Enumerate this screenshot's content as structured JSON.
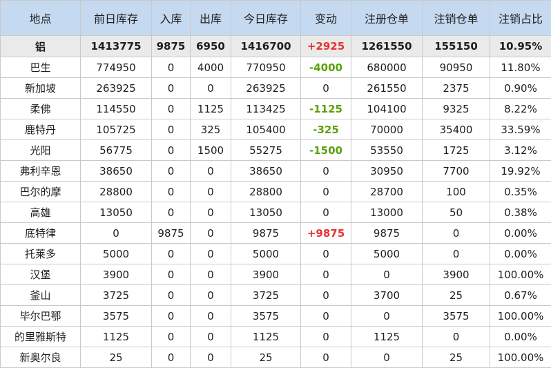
{
  "headers": [
    "地点",
    "前日库存",
    "入库",
    "出库",
    "今日库存",
    "变动",
    "注册仓单",
    "注销仓单",
    "注销占比"
  ],
  "rows": [
    [
      "铝",
      "1413775",
      "9875",
      "6950",
      "1416700",
      "+2925",
      "1261550",
      "155150",
      "10.95%"
    ],
    [
      "巴生",
      "774950",
      "0",
      "4000",
      "770950",
      "-4000",
      "680000",
      "90950",
      "11.80%"
    ],
    [
      "新加坡",
      "263925",
      "0",
      "0",
      "263925",
      "0",
      "261550",
      "2375",
      "0.90%"
    ],
    [
      "柔佛",
      "114550",
      "0",
      "1125",
      "113425",
      "-1125",
      "104100",
      "9325",
      "8.22%"
    ],
    [
      "鹿特丹",
      "105725",
      "0",
      "325",
      "105400",
      "-325",
      "70000",
      "35400",
      "33.59%"
    ],
    [
      "光阳",
      "56775",
      "0",
      "1500",
      "55275",
      "-1500",
      "53550",
      "1725",
      "3.12%"
    ],
    [
      "弗利辛恩",
      "38650",
      "0",
      "0",
      "38650",
      "0",
      "30950",
      "7700",
      "19.92%"
    ],
    [
      "巴尔的摩",
      "28800",
      "0",
      "0",
      "28800",
      "0",
      "28700",
      "100",
      "0.35%"
    ],
    [
      "高雄",
      "13050",
      "0",
      "0",
      "13050",
      "0",
      "13000",
      "50",
      "0.38%"
    ],
    [
      "底特律",
      "0",
      "9875",
      "0",
      "9875",
      "+9875",
      "9875",
      "0",
      "0.00%"
    ],
    [
      "托莱多",
      "5000",
      "0",
      "0",
      "5000",
      "0",
      "5000",
      "0",
      "0.00%"
    ],
    [
      "汉堡",
      "3900",
      "0",
      "0",
      "3900",
      "0",
      "0",
      "3900",
      "100.00%"
    ],
    [
      "釜山",
      "3725",
      "0",
      "0",
      "3725",
      "0",
      "3700",
      "25",
      "0.67%"
    ],
    [
      "毕尔巴鄂",
      "3575",
      "0",
      "0",
      "3575",
      "0",
      "0",
      "3575",
      "100.00%"
    ],
    [
      "的里雅斯特",
      "1125",
      "0",
      "0",
      "1125",
      "0",
      "1125",
      "0",
      "0.00%"
    ],
    [
      "新奥尔良",
      "25",
      "0",
      "0",
      "25",
      "0",
      "0",
      "25",
      "100.00%"
    ]
  ],
  "colors": {
    "header_bg": "#c5d9f1",
    "total_bg": "#eaeaea",
    "increase": "#e53333",
    "decrease": "#5ba10c",
    "border": "#c9c9c9"
  }
}
